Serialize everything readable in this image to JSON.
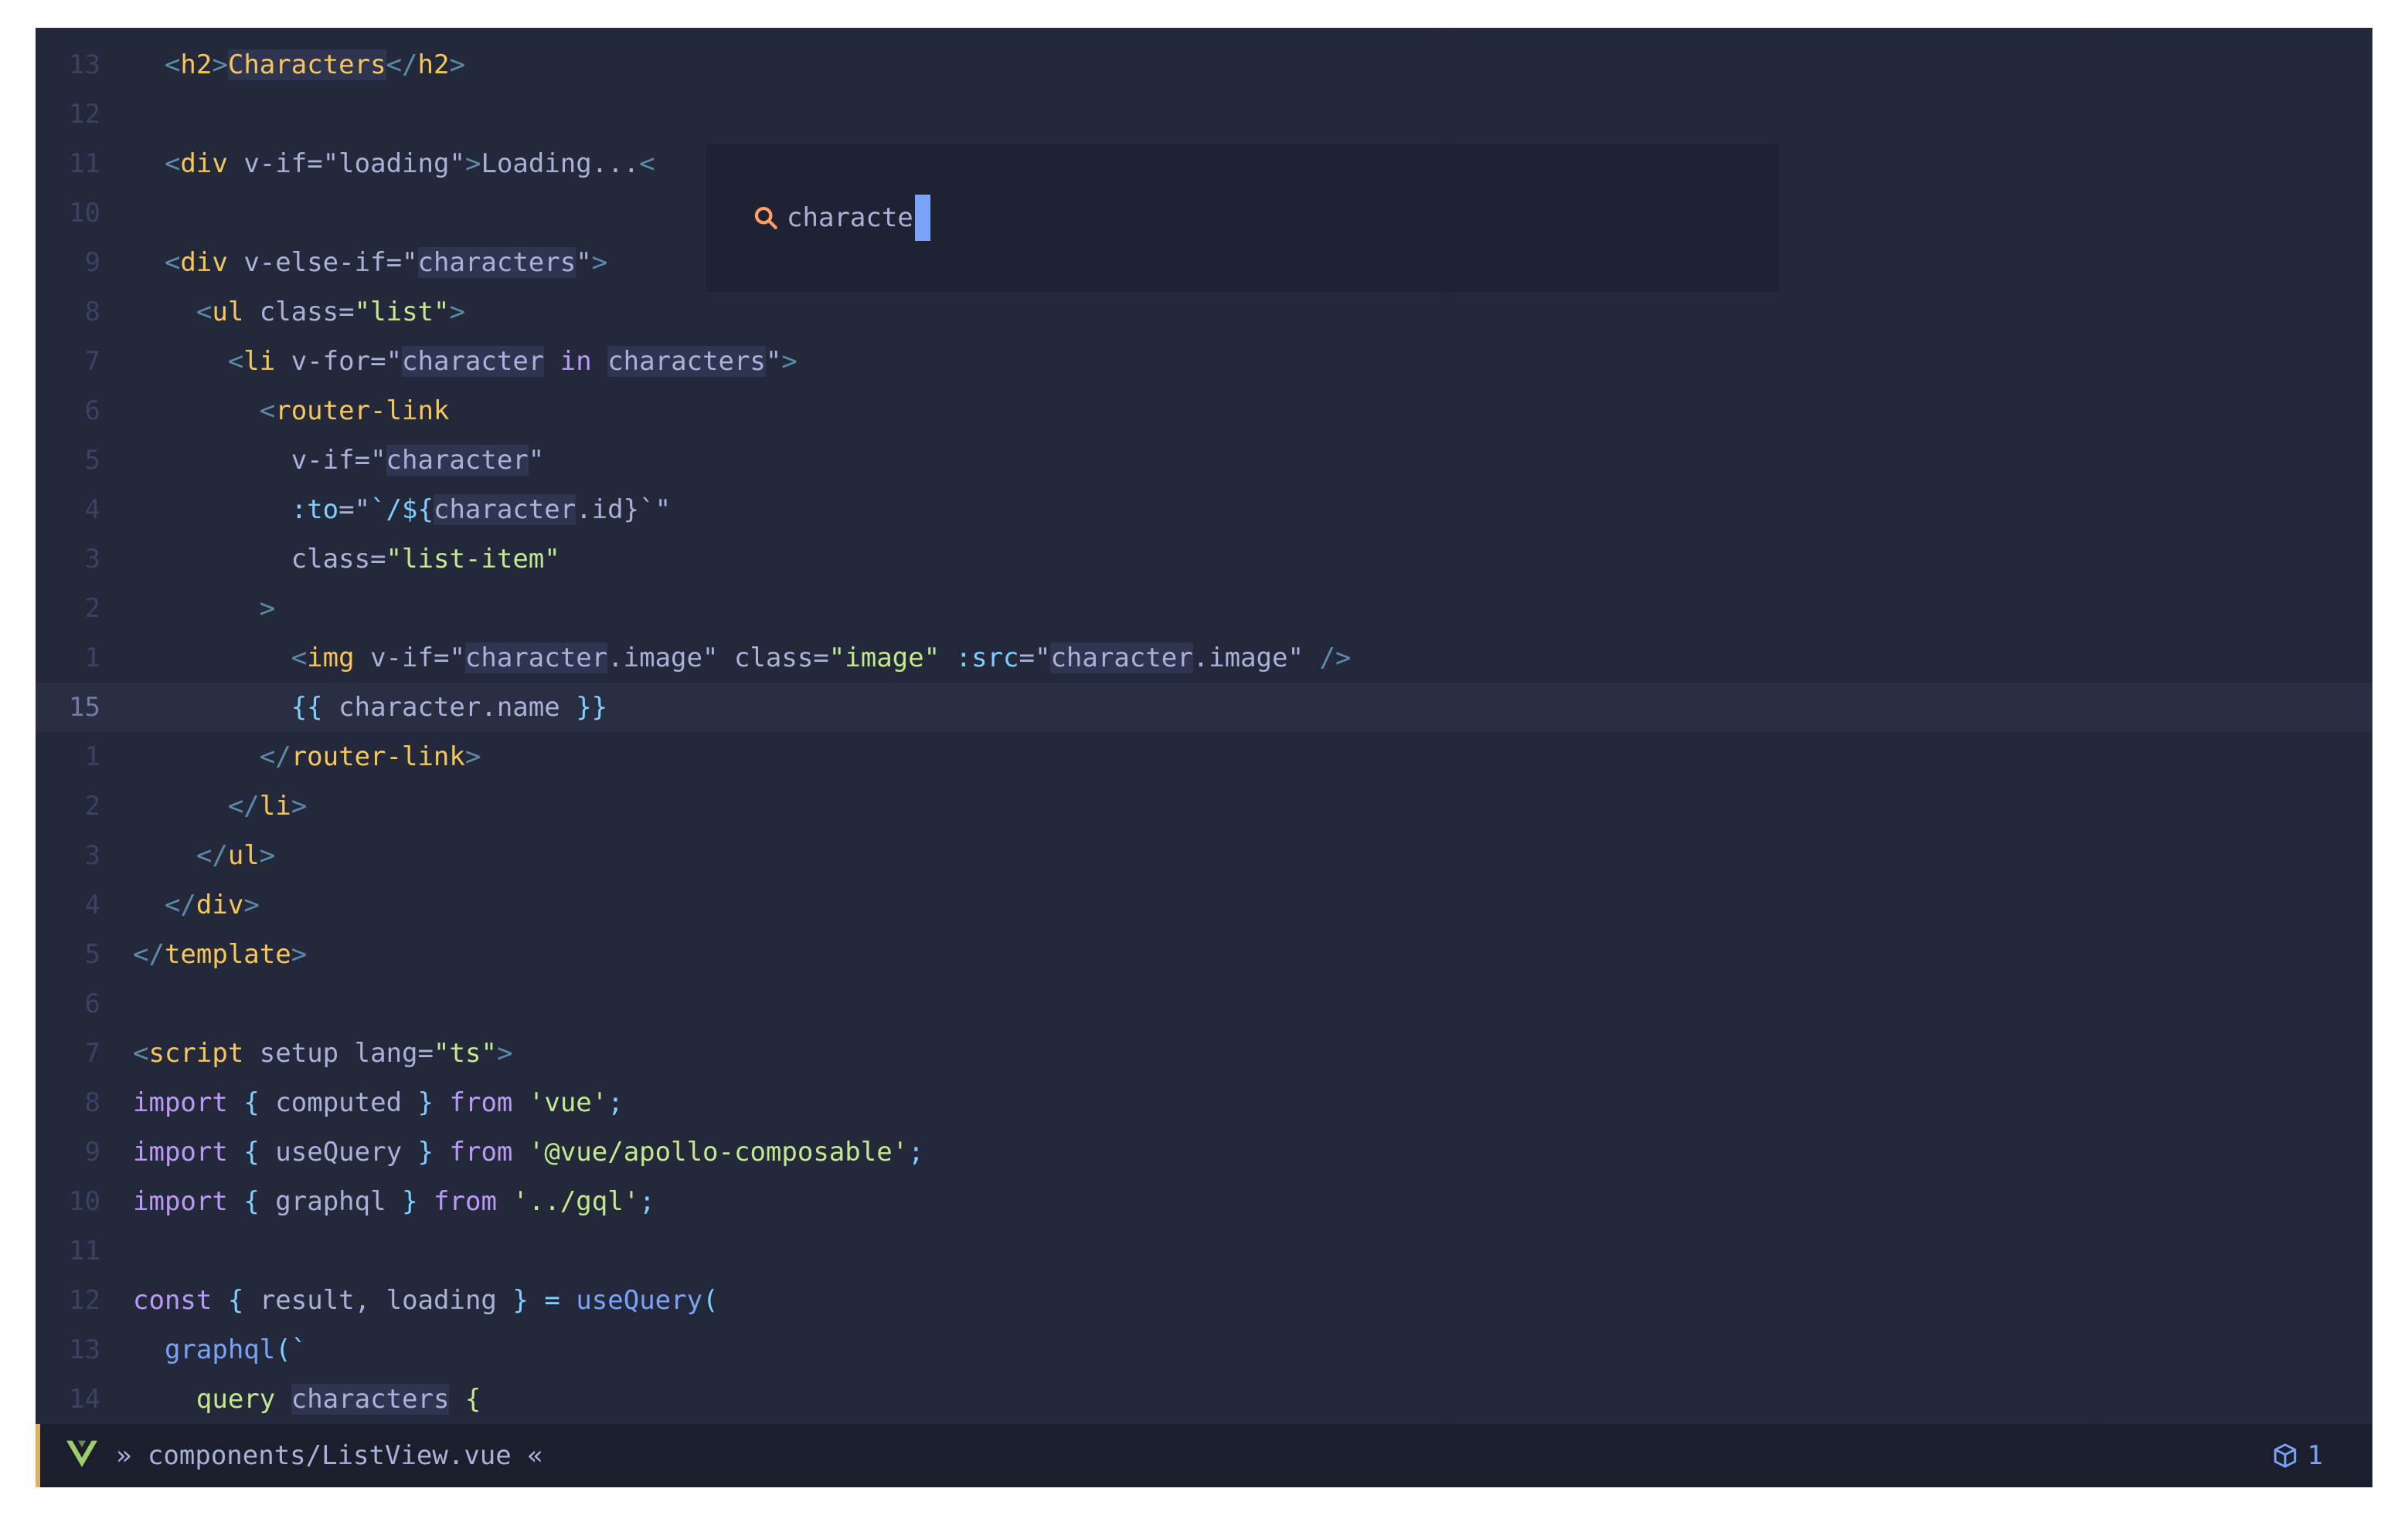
{
  "editor": {
    "lines": [
      {
        "n": "13"
      },
      {
        "n": "12"
      },
      {
        "n": "11"
      },
      {
        "n": "10"
      },
      {
        "n": "9"
      },
      {
        "n": "8"
      },
      {
        "n": "7"
      },
      {
        "n": "6"
      },
      {
        "n": "5"
      },
      {
        "n": "4"
      },
      {
        "n": "3"
      },
      {
        "n": "2"
      },
      {
        "n": "1"
      },
      {
        "n": "15"
      },
      {
        "n": "1"
      },
      {
        "n": "2"
      },
      {
        "n": "3"
      },
      {
        "n": "4"
      },
      {
        "n": "5"
      },
      {
        "n": "6"
      },
      {
        "n": "7"
      },
      {
        "n": "8"
      },
      {
        "n": "9"
      },
      {
        "n": "10"
      },
      {
        "n": "11"
      },
      {
        "n": "12"
      },
      {
        "n": "13"
      },
      {
        "n": "14"
      }
    ],
    "tokens": {
      "l0_tag": "h2",
      "l0_text": "Characters",
      "l2_tag": "div",
      "l2_attr": "v-if",
      "l2_val": "loading",
      "l2_text": "Loading...",
      "l4_tag": "div",
      "l4_attr": "v-else-if",
      "l4_val": "characters",
      "l5_tag": "ul",
      "l5_attr": "class",
      "l5_val": "list",
      "l6_tag": "li",
      "l6_attr": "v-for",
      "l6_v1": "character",
      "l6_in": "in",
      "l6_v2": "characters",
      "l7_tag": "router-link",
      "l8_attr": "v-if",
      "l8_val": "character",
      "l9_bind": ":to",
      "l9_pre": "`/${",
      "l9_var": "character",
      "l9_post": ".id}`",
      "l10_attr": "class",
      "l10_val": "list-item",
      "l11_text": ">",
      "l12_tag": "img",
      "l12_a1": "v-if",
      "l12_v1a": "character",
      "l12_v1b": ".image",
      "l12_a2": "class",
      "l12_v2": "image",
      "l12_a3": ":src",
      "l12_v3a": "character",
      "l12_v3b": ".image",
      "l13_open": "{{",
      "l13_expr": "character.name",
      "l13_close": "}}",
      "l14_tag": "router-link",
      "l15_tag": "li",
      "l16_tag": "ul",
      "l17_tag": "div",
      "l18_tag": "template",
      "l20_tag": "script",
      "l20_a1": "setup",
      "l20_a2": "lang",
      "l20_v2": "ts",
      "l21_kw": "import",
      "l21_name": "computed",
      "l21_from": "from",
      "l21_mod": "'vue'",
      "l22_kw": "import",
      "l22_name": "useQuery",
      "l22_from": "from",
      "l22_mod": "'@vue/apollo-composable'",
      "l23_kw": "import",
      "l23_name": "graphql",
      "l23_from": "from",
      "l23_mod": "'../gql'",
      "l25_kw": "const",
      "l25_v1": "result",
      "l25_v2": "loading",
      "l25_fn": "useQuery",
      "l26_fn": "graphql",
      "l27_kw": "query",
      "l27_name": "characters"
    }
  },
  "search": {
    "query": "characte"
  },
  "statusbar": {
    "file_path": "» components/ListView.vue «",
    "count": "1",
    "accent": "#e0af68"
  }
}
